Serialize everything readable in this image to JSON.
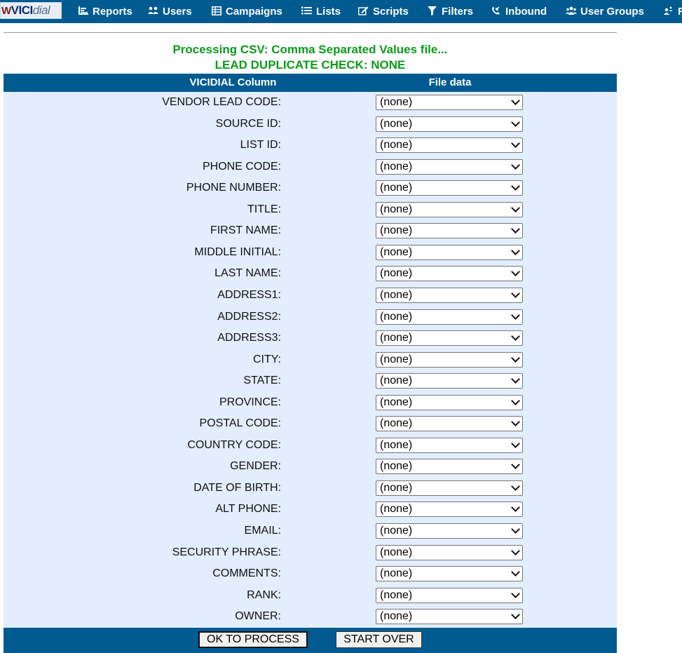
{
  "nav": {
    "logo": {
      "mark": "W",
      "vici": "VICI",
      "dial": "dial"
    },
    "items": [
      {
        "label": "Reports",
        "icon": "bar-chart-icon"
      },
      {
        "label": "Users",
        "icon": "users-icon"
      },
      {
        "label": "Campaigns",
        "icon": "table-icon"
      },
      {
        "label": "Lists",
        "icon": "list-icon"
      },
      {
        "label": "Scripts",
        "icon": "edit-icon"
      },
      {
        "label": "Filters",
        "icon": "filter-icon"
      },
      {
        "label": "Inbound",
        "icon": "phone-incoming-icon"
      },
      {
        "label": "User Groups",
        "icon": "user-groups-icon"
      },
      {
        "label": "R",
        "icon": "remote-agents-icon"
      }
    ]
  },
  "processing": {
    "title": "Processing CSV: Comma Separated Values file...",
    "duplicate_check": "LEAD DUPLICATE CHECK: NONE"
  },
  "table": {
    "col_vicidial": "VICIDIAL Column",
    "col_file": "File data",
    "rows": [
      {
        "label": "VENDOR LEAD CODE:",
        "value": "(none)"
      },
      {
        "label": "SOURCE ID:",
        "value": "(none)"
      },
      {
        "label": "LIST ID:",
        "value": "(none)"
      },
      {
        "label": "PHONE CODE:",
        "value": "(none)"
      },
      {
        "label": "PHONE NUMBER:",
        "value": "(none)"
      },
      {
        "label": "TITLE:",
        "value": "(none)"
      },
      {
        "label": "FIRST NAME:",
        "value": "(none)"
      },
      {
        "label": "MIDDLE INITIAL:",
        "value": "(none)"
      },
      {
        "label": "LAST NAME:",
        "value": "(none)"
      },
      {
        "label": "ADDRESS1:",
        "value": "(none)"
      },
      {
        "label": "ADDRESS2:",
        "value": "(none)"
      },
      {
        "label": "ADDRESS3:",
        "value": "(none)"
      },
      {
        "label": "CITY:",
        "value": "(none)"
      },
      {
        "label": "STATE:",
        "value": "(none)"
      },
      {
        "label": "PROVINCE:",
        "value": "(none)"
      },
      {
        "label": "POSTAL CODE:",
        "value": "(none)"
      },
      {
        "label": "COUNTRY CODE:",
        "value": "(none)"
      },
      {
        "label": "GENDER:",
        "value": "(none)"
      },
      {
        "label": "DATE OF BIRTH:",
        "value": "(none)"
      },
      {
        "label": "ALT PHONE:",
        "value": "(none)"
      },
      {
        "label": "EMAIL:",
        "value": "(none)"
      },
      {
        "label": "SECURITY PHRASE:",
        "value": "(none)"
      },
      {
        "label": "COMMENTS:",
        "value": "(none)"
      },
      {
        "label": "RANK:",
        "value": "(none)"
      },
      {
        "label": "OWNER:",
        "value": "(none)"
      }
    ]
  },
  "buttons": {
    "ok": "OK TO PROCESS",
    "start_over": "START OVER"
  },
  "colors": {
    "nav_bg": "#015b91",
    "heading": "#0c9a1b",
    "table_bg": "#e2edfd"
  }
}
